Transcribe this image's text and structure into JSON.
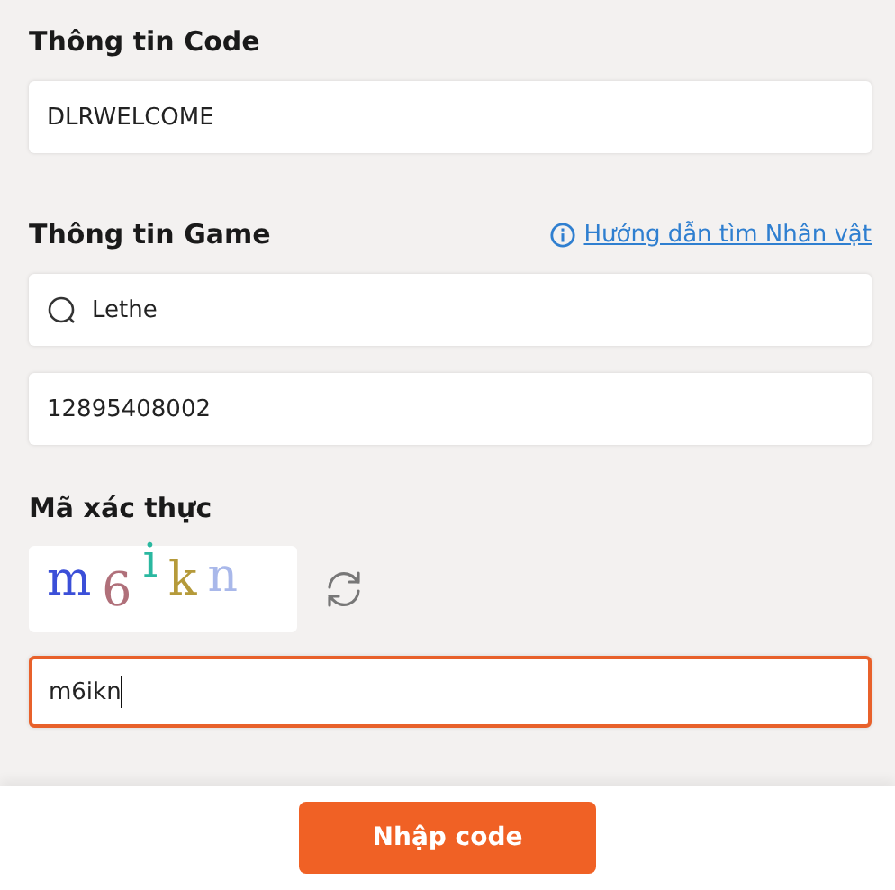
{
  "code_section": {
    "title": "Thông tin Code",
    "code_field": {
      "value": "DLRWELCOME"
    }
  },
  "game_section": {
    "title": "Thông tin Game",
    "help_link": "Hướng dẫn tìm Nhân vật",
    "character_field": {
      "value": "Lethe"
    },
    "id_field": {
      "value": "12895408002"
    }
  },
  "captcha_section": {
    "title": "Mã xác thực",
    "captcha_chars": [
      {
        "char": "m",
        "color": "#3b4fd8"
      },
      {
        "char": "6",
        "color": "#b0707a"
      },
      {
        "char": "i",
        "color": "#2ab8a0"
      },
      {
        "char": "k",
        "color": "#b59a3a"
      },
      {
        "char": "n",
        "color": "#a9b8ea"
      }
    ],
    "captcha_field": {
      "value": "m6ikn",
      "focused": true
    }
  },
  "submit_button": "Nhập code"
}
